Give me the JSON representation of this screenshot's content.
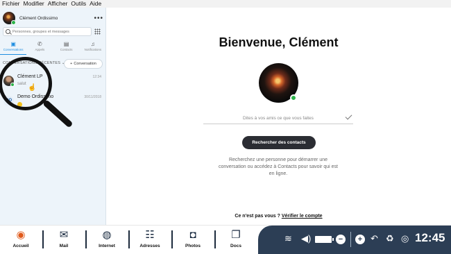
{
  "menubar": {
    "items": [
      "Fichier",
      "Modifier",
      "Afficher",
      "Outils",
      "Aide"
    ]
  },
  "sidebar": {
    "profile_name": "Clément Ordissimo",
    "more_label": "•••",
    "search_placeholder": "Personnes, groupes et messages",
    "tabs": [
      {
        "label": "Conversations",
        "icon": "chat-icon"
      },
      {
        "label": "Appels",
        "icon": "phone-icon"
      },
      {
        "label": "Contacts",
        "icon": "contacts-icon"
      },
      {
        "label": "Notifications",
        "icon": "bell-icon"
      }
    ],
    "recent_header": "CONVERSATIONS RÉCENTES",
    "new_conversation_label": "Conversation",
    "conversations": [
      {
        "name": "Clément LP",
        "message": "salut",
        "time": "12:34"
      },
      {
        "name": "Demo Ordissimo",
        "message": "",
        "time": "30/11/2018",
        "avatar_text": "OO"
      }
    ]
  },
  "main": {
    "welcome": "Bienvenue, Clément",
    "mood_placeholder": "Dites à vos amis ce que vous faites",
    "find_contacts_label": "Rechercher des contacts",
    "hint": "Recherchez une personne pour démarrer une conversation ou accédez à Contacts pour savoir qui est en ligne.",
    "not_you": "Ce n'est pas vous ?",
    "verify_link": "Vérifier le compte"
  },
  "taskbar": {
    "items": [
      {
        "label": "Accueil",
        "icon": "home-logo-icon"
      },
      {
        "label": "Mail",
        "icon": "mail-icon"
      },
      {
        "label": "Internet",
        "icon": "globe-icon"
      },
      {
        "label": "Adresses",
        "icon": "address-book-icon"
      },
      {
        "label": "Photos",
        "icon": "camera-icon"
      },
      {
        "label": "Docs",
        "icon": "docs-icon"
      }
    ],
    "clock": "12:45",
    "colors": {
      "tray_bg": "#2c3e55",
      "accent": "#1e8de0",
      "online": "#2cb34a"
    }
  }
}
